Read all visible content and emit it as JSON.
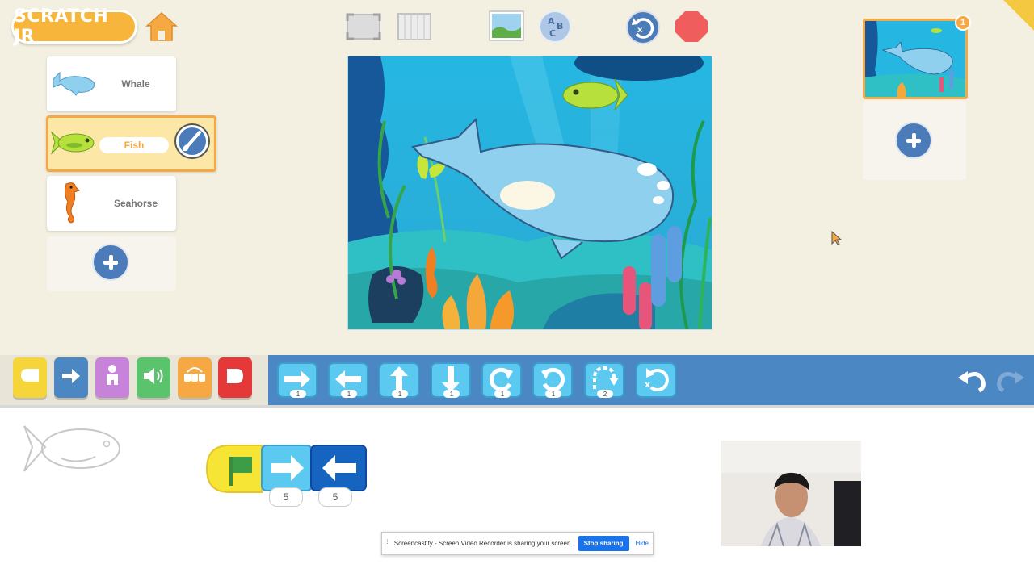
{
  "app": {
    "logo_text": "SCRATCH JR"
  },
  "colors": {
    "background": "#f3f0e2",
    "accent_orange": "#f6a843",
    "palette_blue": "#4a87c3",
    "motion_block": "#5cc9f0",
    "plus_button": "#4b7bb9",
    "stop_red": "#ef5d5d"
  },
  "toolbar": {
    "fullscreen": "fullscreen-icon",
    "grid": "grid-icon",
    "background": "background-picker-icon",
    "text": "text-abc-icon",
    "reset": "reset-characters-icon",
    "stop": "stop-icon"
  },
  "sprites": [
    {
      "name": "Whale",
      "icon": "whale-icon"
    },
    {
      "name": "Fish",
      "icon": "fish-icon",
      "selected": true,
      "edit_icon": "paintbrush-icon"
    },
    {
      "name": "Seahorse",
      "icon": "seahorse-icon"
    }
  ],
  "pages": {
    "items": [
      {
        "number": "1"
      }
    ]
  },
  "categories": [
    "triggering",
    "motion",
    "looks",
    "sound",
    "control",
    "end"
  ],
  "motion_blocks": [
    {
      "name": "move-right",
      "param": "1"
    },
    {
      "name": "move-left",
      "param": "1"
    },
    {
      "name": "move-up",
      "param": "1"
    },
    {
      "name": "move-down",
      "param": "1"
    },
    {
      "name": "turn-right",
      "param": "1"
    },
    {
      "name": "turn-left",
      "param": "1"
    },
    {
      "name": "hop",
      "param": "2"
    },
    {
      "name": "go-home",
      "param": ""
    }
  ],
  "script": {
    "blocks": [
      {
        "type": "green-flag-start",
        "param": ""
      },
      {
        "type": "move-right",
        "param": "5"
      },
      {
        "type": "move-left",
        "param": "5"
      }
    ]
  },
  "share_bar": {
    "message": "Screencastify - Screen Video Recorder is sharing your screen.",
    "stop_label": "Stop sharing",
    "hide_label": "Hide"
  }
}
